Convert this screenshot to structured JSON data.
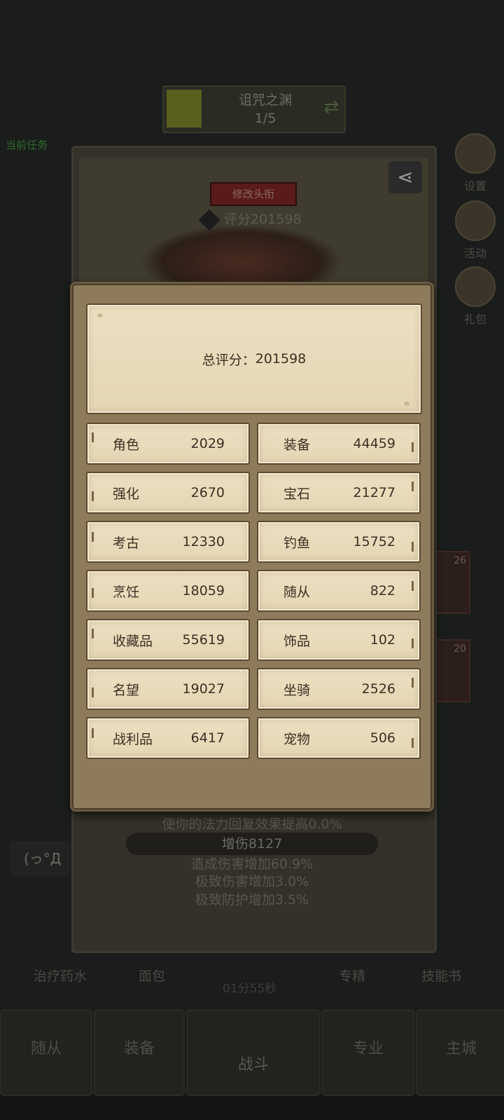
{
  "background": {
    "stage_title": "诅咒之渊",
    "stage_progress": "1/5",
    "quest_text": "当前任务",
    "side_buttons": [
      "设置",
      "活动",
      "礼包"
    ],
    "rename_button": "修改头衔",
    "score_text": "评分201598",
    "effect_lines": [
      "使你的法力回复效果提高0.0%",
      "增伤8127",
      "造成伤害增加60.9%",
      "极致伤害增加3.0%",
      "极致防护增加3.5%"
    ],
    "items": [
      "治疗药水",
      "面包",
      "专精",
      "技能书"
    ],
    "timer": "01分55秒",
    "nav": [
      "随从",
      "装备",
      "战斗",
      "专业",
      "主城"
    ],
    "chat_text": "(っ°Д",
    "card_levels": [
      "26",
      "20"
    ]
  },
  "modal": {
    "total_label": "总评分：",
    "total_value": "201598",
    "stats": [
      {
        "label": "角色",
        "value": "2029"
      },
      {
        "label": "装备",
        "value": "44459"
      },
      {
        "label": "强化",
        "value": "2670"
      },
      {
        "label": "宝石",
        "value": "21277"
      },
      {
        "label": "考古",
        "value": "12330"
      },
      {
        "label": "钓鱼",
        "value": "15752"
      },
      {
        "label": "烹饪",
        "value": "18059"
      },
      {
        "label": "随从",
        "value": "822"
      },
      {
        "label": "收藏品",
        "value": "55619"
      },
      {
        "label": "饰品",
        "value": "102"
      },
      {
        "label": "名望",
        "value": "19027"
      },
      {
        "label": "坐骑",
        "value": "2526"
      },
      {
        "label": "战利品",
        "value": "6417"
      },
      {
        "label": "宠物",
        "value": "506"
      }
    ]
  }
}
